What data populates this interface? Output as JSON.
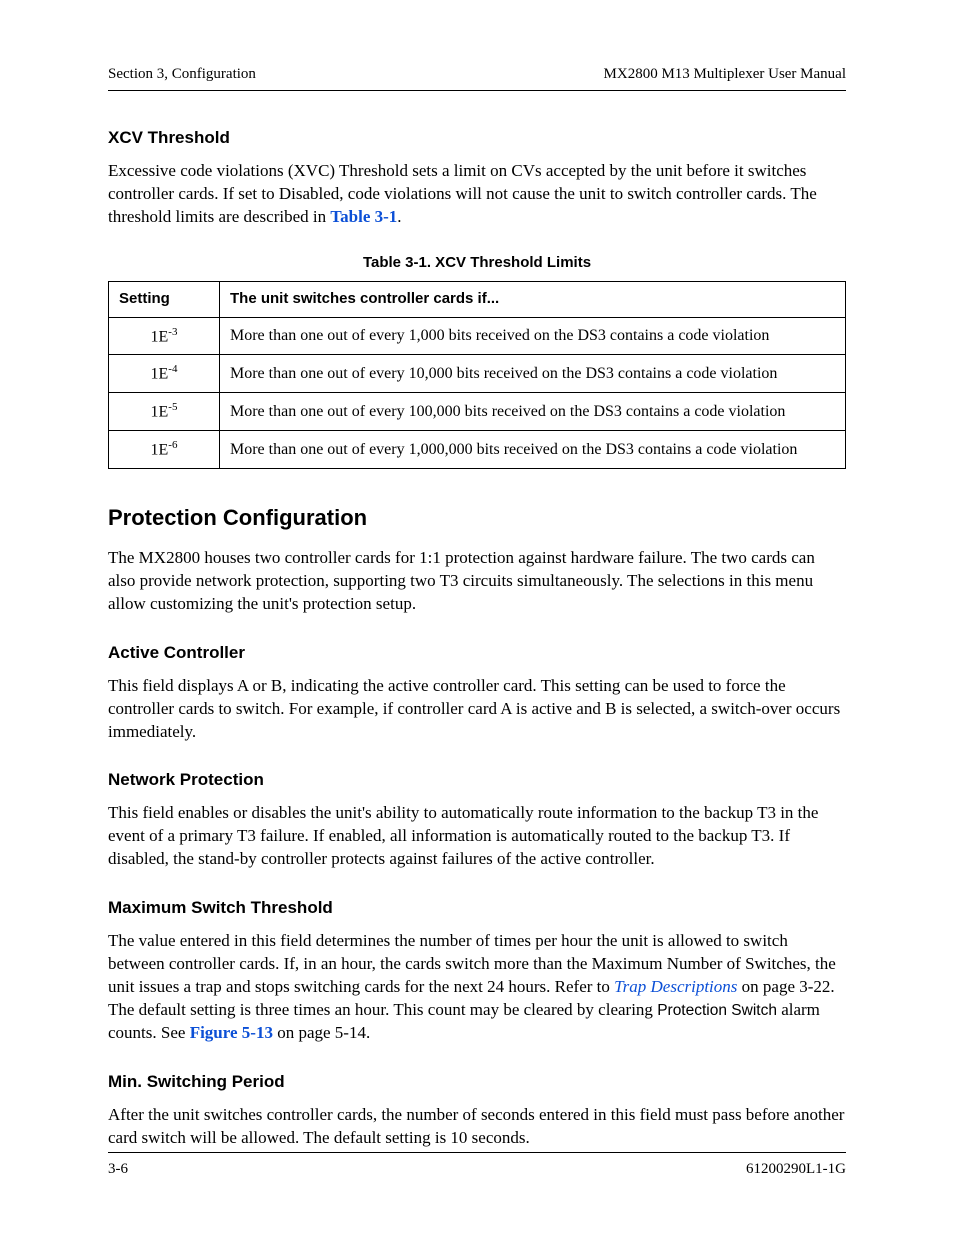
{
  "header": {
    "left": "Section 3, Configuration",
    "right": "MX2800 M13 Multiplexer User Manual"
  },
  "xcv": {
    "heading": "XCV Threshold",
    "para_a": "Excessive code violations (XVC) Threshold sets a limit on CVs accepted by the unit before it switches controller cards. If set to Disabled, code violations will not cause the unit to switch controller cards. The threshold limits are described in ",
    "para_link": "Table 3-1",
    "para_b": "."
  },
  "table": {
    "caption": "Table 3-1.  XCV Threshold Limits",
    "col1": "Setting",
    "col2": "The unit switches controller cards if...",
    "rows": [
      {
        "base": "1E",
        "exp": "-3",
        "desc": "More than one out of every 1,000 bits received on the DS3 contains a code violation"
      },
      {
        "base": "1E",
        "exp": "-4",
        "desc": "More than one out of every 10,000 bits received on the DS3 contains a code violation"
      },
      {
        "base": "1E",
        "exp": "-5",
        "desc": "More than one out of every 100,000 bits received on the DS3 contains a code violation"
      },
      {
        "base": "1E",
        "exp": "-6",
        "desc": "More than one out of every 1,000,000 bits received on the DS3 contains a code violation"
      }
    ]
  },
  "protection": {
    "heading": "Protection Configuration",
    "para": "The MX2800 houses two controller cards for 1:1 protection against hardware failure. The two cards can also provide network protection, supporting two T3 circuits simultaneously. The selections in this menu allow customizing the unit's protection setup."
  },
  "active": {
    "heading": "Active Controller",
    "para": "This field displays A or B, indicating the active controller card. This setting can be used to force the controller cards to switch. For example, if controller card A is active and B is selected, a switch-over occurs immediately."
  },
  "netprot": {
    "heading": "Network Protection",
    "para": "This field enables or disables the unit's ability to automatically route information to the backup T3 in the event of a primary T3 failure. If enabled, all information is automatically routed to the backup T3. If disabled, the stand-by controller protects against failures of the active controller."
  },
  "maxswitch": {
    "heading": "Maximum Switch Threshold",
    "p1": "The value entered in this field determines the number of times per hour the unit is allowed to switch between controller cards. If, in an hour, the cards switch more than the Maximum Number of Switches, the unit issues a trap and stops switching cards for the next 24 hours. Refer to ",
    "link1": "Trap Descriptions",
    "p2": " on page 3-22. The default setting is three times an hour. This count may be cleared by clearing ",
    "sans": "Protection Switch",
    "p3": " alarm counts. See ",
    "link2": "Figure 5-13",
    "p4": " on page 5-14."
  },
  "minswitch": {
    "heading": "Min. Switching Period",
    "para": "After the unit switches controller cards, the number of seconds entered in this field must pass before another card switch will be allowed. The default setting is 10 seconds."
  },
  "footer": {
    "left": "3-6",
    "right": "61200290L1-1G"
  }
}
